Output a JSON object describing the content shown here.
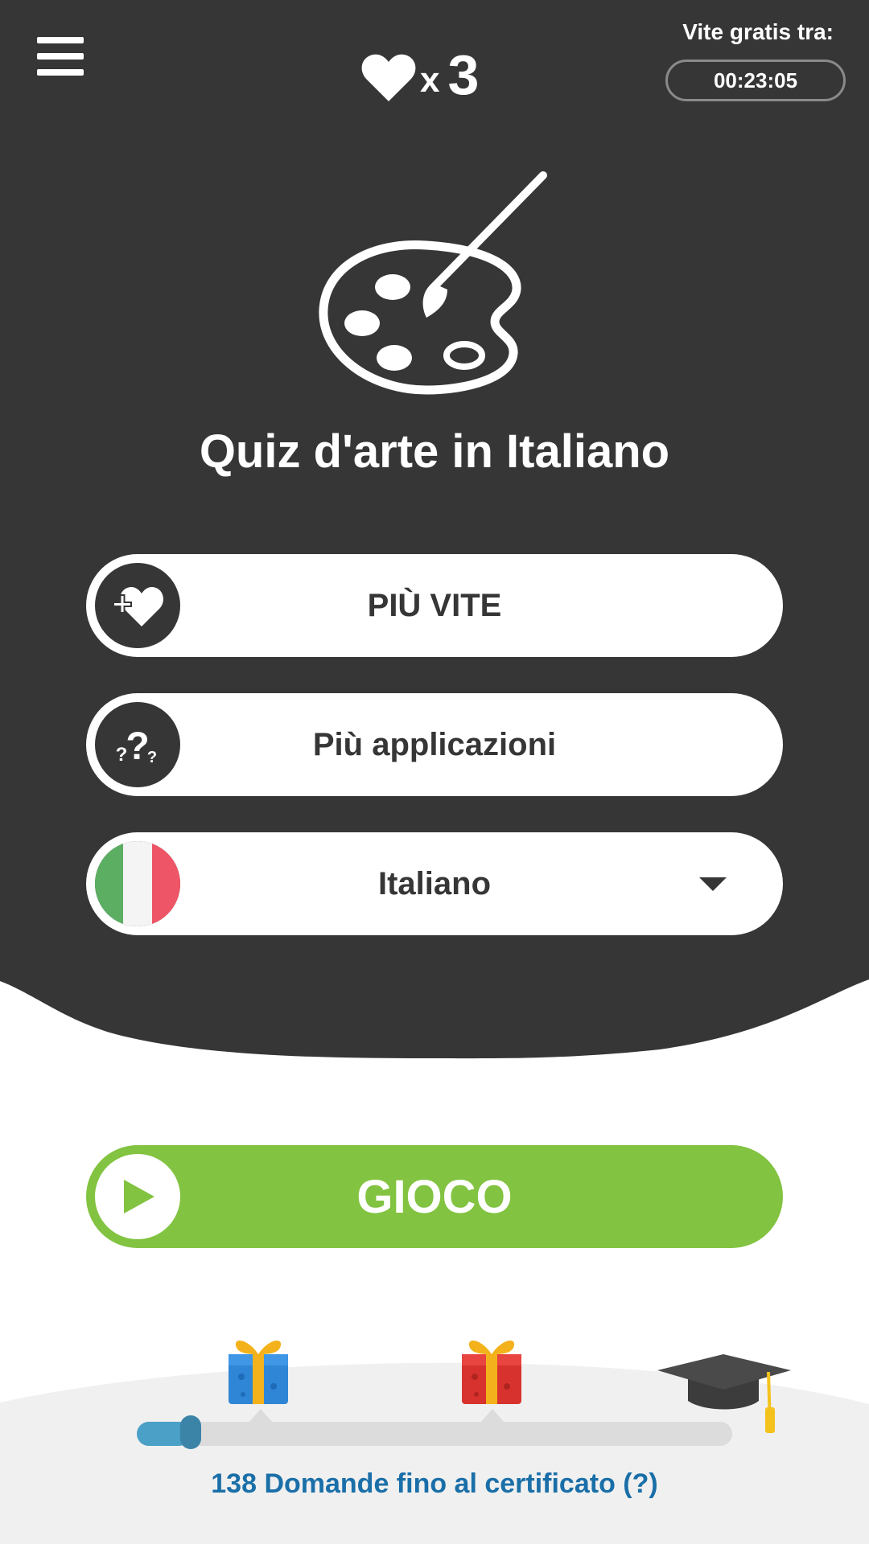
{
  "header": {
    "menu_icon": "hamburger-menu-icon",
    "lives_icon": "heart-icon",
    "lives_multiplier": "x",
    "lives_count": "3",
    "free_lives_label": "Vite gratis tra:",
    "free_lives_timer": "00:23:05"
  },
  "hero": {
    "icon": "palette-brush-icon",
    "title": "Quiz d'arte in Italiano"
  },
  "buttons": {
    "more_lives": {
      "label": "PIÙ VITE",
      "icon": "heart-plus-icon"
    },
    "more_apps": {
      "label": "Più applicazioni",
      "icon": "question-marks-icon"
    },
    "language": {
      "label": "Italiano",
      "icon": "italy-flag-icon",
      "flag_colors": [
        "#5cae63",
        "#f4f4f4",
        "#ee5566"
      ]
    },
    "play": {
      "label": "GIOCO",
      "icon": "play-icon"
    }
  },
  "progress": {
    "value_fraction": 0.09,
    "milestones": [
      "gift-blue-icon",
      "gift-red-icon",
      "graduation-cap-icon"
    ],
    "caption": "138 Domande fino al certificato (?)"
  },
  "colors": {
    "dark_bg": "#363636",
    "play_green": "#82c341",
    "progress_blue": "#4aa0c6",
    "link_blue": "#1a6fa8"
  }
}
